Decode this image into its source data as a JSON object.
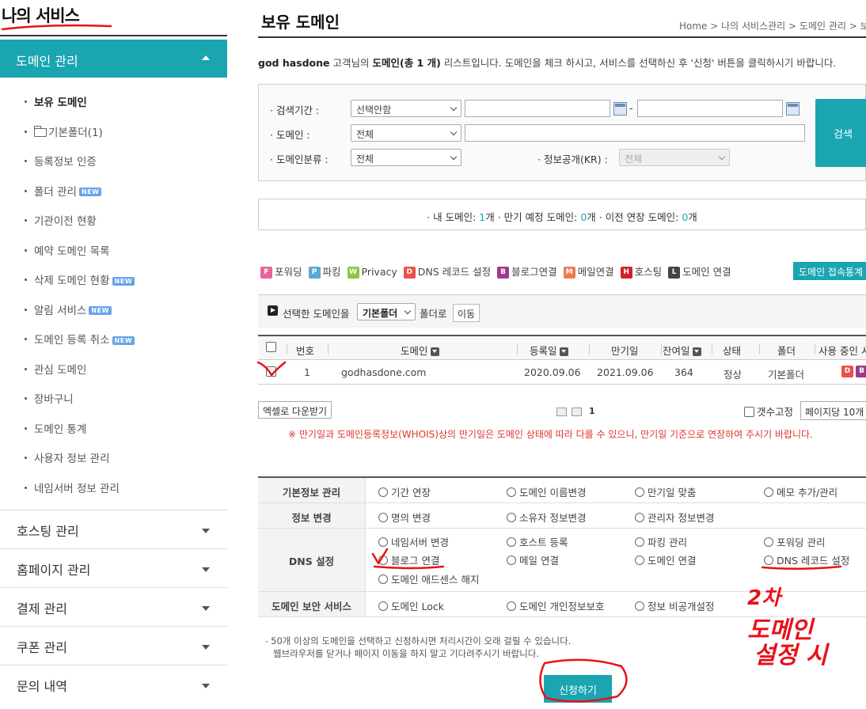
{
  "sidebar": {
    "title": "나의 서비스",
    "active_menu": "도메인 관리",
    "sub_items": [
      "보유 도메인",
      "기본폴더(1)",
      "등록정보 인증",
      "폴더 관리",
      "기관이전 현황",
      "예약 도메인 목록",
      "삭제 도메인 현황",
      "알림 서비스",
      "도메인 등록 취소",
      "관심 도메인",
      "장바구니",
      "도메인 통계",
      "사용자 정보 관리",
      "네임서버 정보 관리"
    ],
    "new_badge": "NEW",
    "menus": [
      "호스팅 관리",
      "홈페이지 관리",
      "결제 관리",
      "쿠폰 관리",
      "문의 내역"
    ]
  },
  "page": {
    "title": "보유 도메인",
    "breadcrumb": "Home > 나의 서비스관리 > 도메인 관리 > 보유",
    "intro": {
      "user": "god hasdone",
      "p1": " 고객님의 ",
      "strong": "도메인(총 1 개)",
      "p2": " 리스트입니다. 도메인을 체크 하시고, 서비스를 선택하신 후 '신청' 버튼을 클릭하시기 바랍니다."
    }
  },
  "search": {
    "period_label": "· 검색기간 :",
    "period_select": "선택안함",
    "domain_label": "· 도메인 :",
    "domain_select": "전체",
    "category_label": "· 도메인분류 :",
    "category_select": "전체",
    "disclosure_label": "· 정보공개(KR) :",
    "disclosure_select": "전체",
    "dash": "-",
    "button": "검색"
  },
  "summary": {
    "my_label": "· 내 도메인: ",
    "my_count": "1",
    "my_unit": "개",
    "exp_label": "  · 만기 예정 도메인: ",
    "exp_count": "0",
    "exp_unit": "개",
    "tr_label": "  · 이전 연장 도메인: ",
    "tr_count": "0",
    "tr_unit": "개"
  },
  "legend": [
    {
      "letter": "F",
      "label": "포워딩",
      "color": "#e8649a"
    },
    {
      "letter": "P",
      "label": "파킹",
      "color": "#5aa8d8"
    },
    {
      "letter": "W",
      "label": "Privacy",
      "color": "#8cc63f"
    },
    {
      "letter": "D",
      "label": "DNS 레코드 설정",
      "color": "#e8524a"
    },
    {
      "letter": "B",
      "label": "블로그연결",
      "color": "#9b3a8e"
    },
    {
      "letter": "M",
      "label": "메일연결",
      "color": "#f07a50"
    },
    {
      "letter": "H",
      "label": "호스팅",
      "color": "#d2232a"
    },
    {
      "letter": "L",
      "label": "도메인 연결",
      "color": "#444444"
    }
  ],
  "access_button": "도메인 접속통계",
  "move": {
    "label": "선택한 도메인을",
    "folder": "기본폴더",
    "to": "폴더로",
    "button": "이동"
  },
  "table": {
    "headers": {
      "num": "번호",
      "domain": "도메인",
      "reg": "등록일",
      "exp": "만기일",
      "days": "잔여일",
      "status": "상태",
      "folder": "폴더",
      "using": "사용 중인 서"
    },
    "rows": [
      {
        "num": "1",
        "domain": "godhasdone.com",
        "reg": "2020.09.06",
        "exp": "2021.09.06",
        "days": "364",
        "status": "정상",
        "folder": "기본폴더"
      }
    ]
  },
  "excel_button": "엑셀로 다운받기",
  "pagination": {
    "current": "1"
  },
  "count_fix": "갯수고정",
  "per_page": "페이지당 10개",
  "warning": "※ 만기일과 도메인등록정보(WHOIS)상의 만기일은 도메인 상태에 따라 다를 수 있으니, 만기일 기준으로 연장하여 주시기 바랍니다.",
  "services": [
    {
      "label": "기본정보 관리",
      "options": [
        "기간 연장",
        "도메인 이름변경",
        "만기일 맞춤",
        "메모 추가/관리"
      ]
    },
    {
      "label": "정보 변경",
      "options": [
        "명의 변경",
        "소유자 정보변경",
        "관리자 정보변경"
      ]
    },
    {
      "label": "DNS 설정",
      "options": [
        "네임서버 변경",
        "호스트 등록",
        "파킹 관리",
        "포워딩 관리",
        "블로그 연결",
        "메일 연결",
        "도메인 연결",
        "DNS 레코드 설정",
        "도메인 애드센스 해지"
      ]
    },
    {
      "label": "도메인 보안 서비스",
      "options": [
        "도메인 Lock",
        "도메인 개인정보보호",
        "정보 비공개설정"
      ]
    }
  ],
  "notes": [
    "50개 이상의 도메인을 선택하고 신청하시면 처리시간이 오래 걸릴 수 있습니다.",
    "웹브라우저를 닫거나 페이지 이동을 하지 말고 기다려주시기 바랍니다."
  ],
  "apply_button": "신청하기",
  "annotation": {
    "line1": "2차",
    "line2": "도메인",
    "line3": "설정 시",
    "color": "#e8111a"
  }
}
